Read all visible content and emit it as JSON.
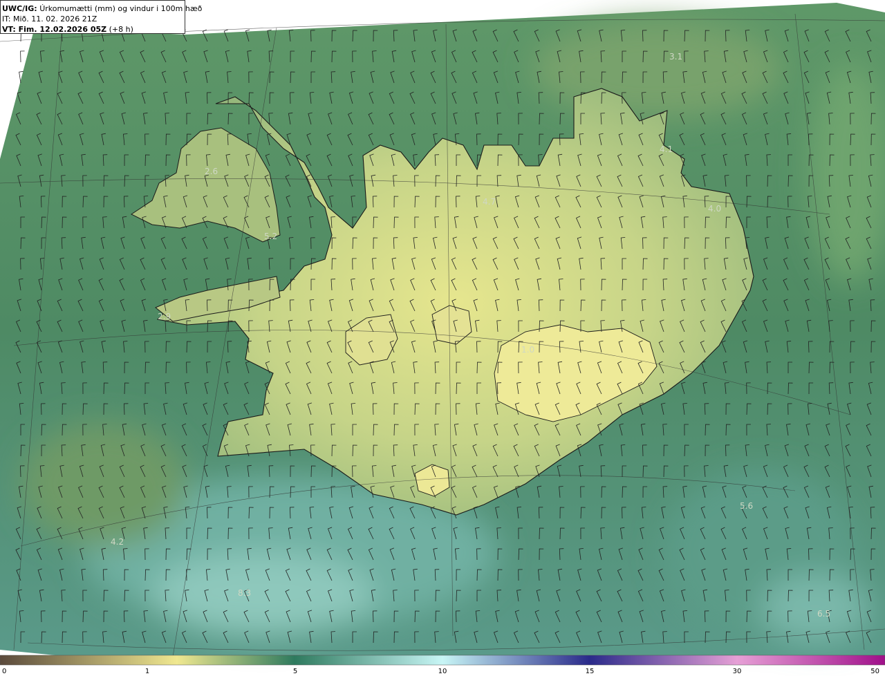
{
  "header": {
    "product": "UWC/IG:",
    "description": "Úrkomumætti (mm) og vindur i 100m hæð",
    "it_label": "IT:",
    "it_value": "Mið. 11. 02. 2026 21Z",
    "vt_label": "VT: Fim. 12.02.2026 05Z",
    "vt_suffix": "(+8 h)"
  },
  "map": {
    "region": "Iceland",
    "field": "precipitable water",
    "units": "mm",
    "overlay": "wind barbs",
    "labels": [
      {
        "text": "3.1"
      },
      {
        "text": "4.1"
      },
      {
        "text": "4.0"
      },
      {
        "text": "2.6"
      },
      {
        "text": "5.2"
      },
      {
        "text": "4.7"
      },
      {
        "text": "2.9"
      },
      {
        "text": "1.0"
      },
      {
        "text": "5.6"
      },
      {
        "text": "4.2"
      },
      {
        "text": "8.3"
      },
      {
        "text": "6.5"
      }
    ]
  },
  "colorbar": {
    "ticks": [
      "0",
      "1",
      "5",
      "10",
      "15",
      "30",
      "50"
    ],
    "colors": [
      "#5a4a3c",
      "#f0e890",
      "#2e7a5e",
      "#c8f6f6",
      "#2a2a8a",
      "#e6a0d6",
      "#a0108a"
    ]
  }
}
